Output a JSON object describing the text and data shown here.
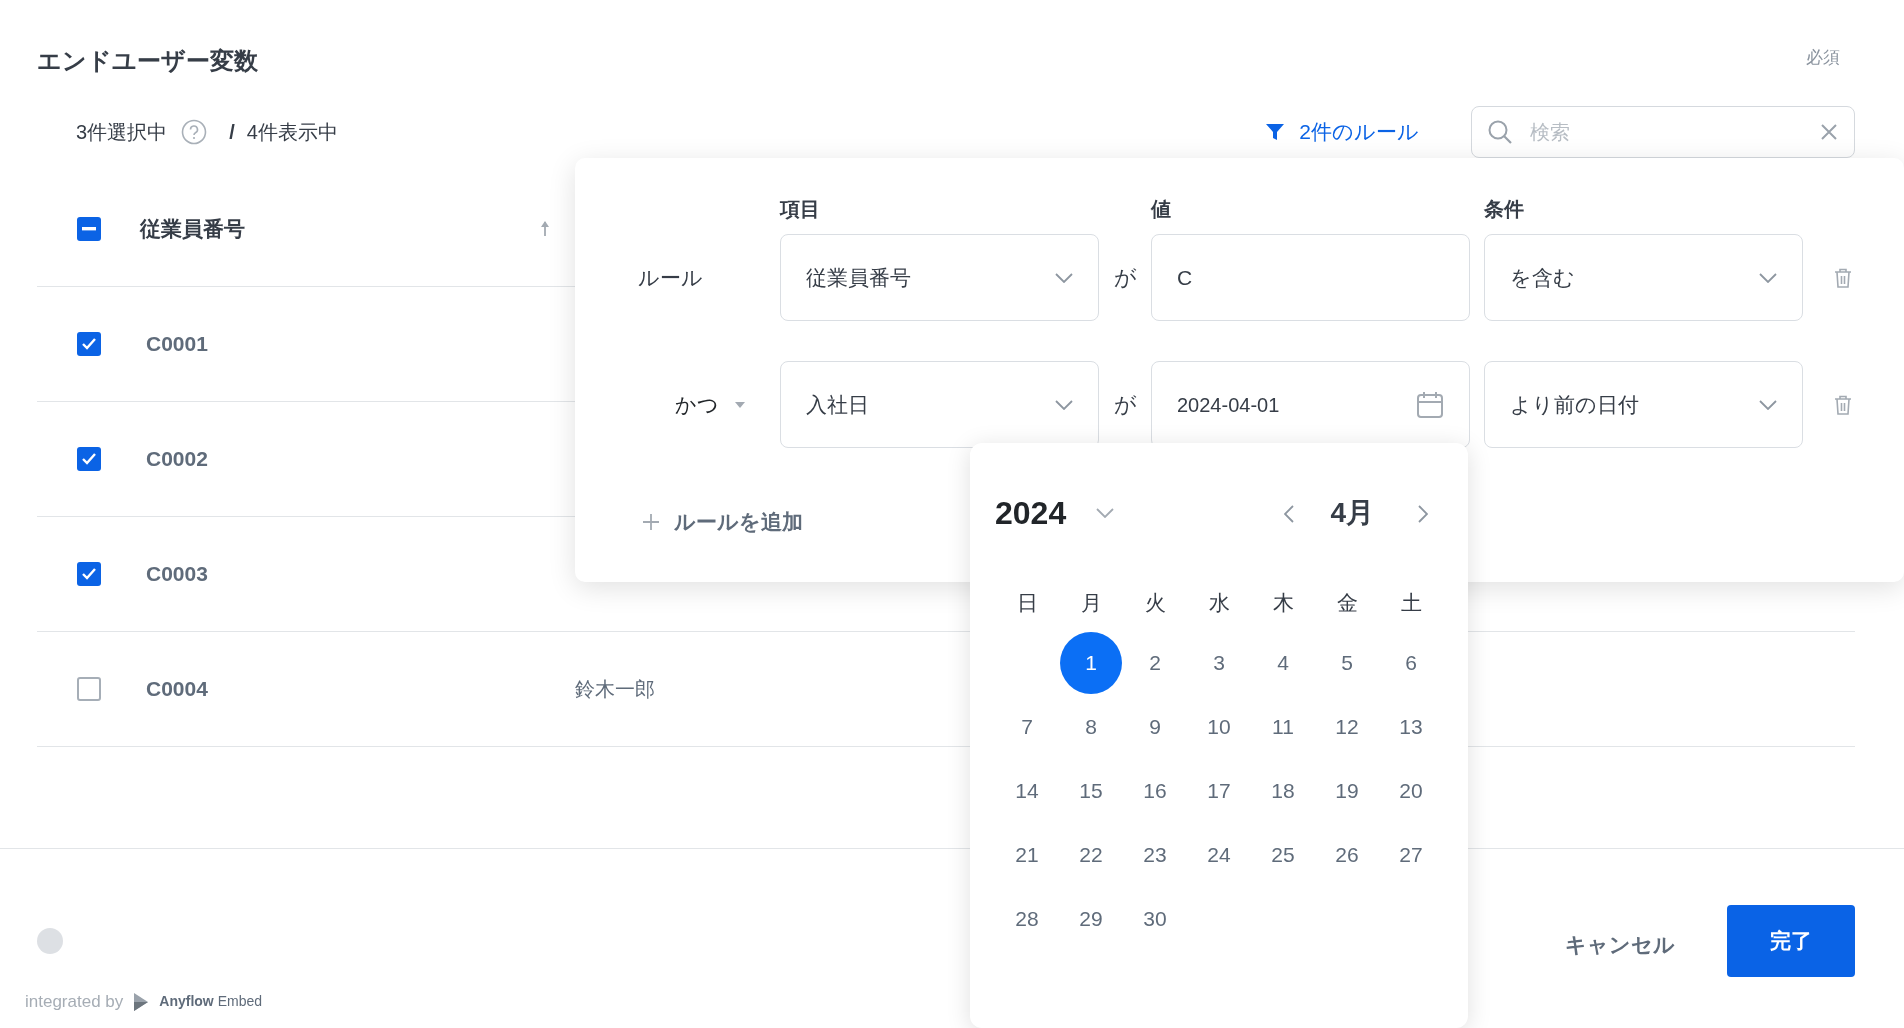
{
  "title": "エンドユーザー変数",
  "required_label": "必須",
  "selection": {
    "selected_text": "3件選択中",
    "separator": "/",
    "shown_text": "4件表示中"
  },
  "filter_button": {
    "label": "2件のルール"
  },
  "search": {
    "placeholder": "検索"
  },
  "table": {
    "header_checked": true,
    "header_indeterminate": true,
    "columns": [
      {
        "label": "従業員番号",
        "sorted_ascending": true
      }
    ],
    "rows": [
      {
        "checked": true,
        "cells": [
          "C0001"
        ]
      },
      {
        "checked": true,
        "cells": [
          "C0002"
        ]
      },
      {
        "checked": true,
        "cells": [
          "C0003"
        ]
      },
      {
        "checked": false,
        "cells": [
          "C0004",
          "鈴木一郎"
        ]
      }
    ]
  },
  "filter_panel": {
    "columns": [
      "項目",
      "値",
      "条件"
    ],
    "rules": [
      {
        "label": {
          "kind": "text",
          "text": "ルール"
        },
        "field": "従業員番号",
        "connector": "が",
        "value": {
          "kind": "text",
          "text": "C"
        },
        "condition": "を含む"
      },
      {
        "label": {
          "kind": "dropdown",
          "text": "かつ"
        },
        "field": "入社日",
        "connector": "が",
        "value": {
          "kind": "date",
          "text": "2024-04-01"
        },
        "condition": "より前の日付"
      }
    ],
    "add_rule": "ルールを追加"
  },
  "date_picker": {
    "year": "2024",
    "month": "4月",
    "weekdays": [
      "日",
      "月",
      "火",
      "水",
      "木",
      "金",
      "土"
    ],
    "weeks": [
      [
        {
          "label": "1",
          "selected": true
        },
        {
          "label": "2",
          "selected": false
        },
        {
          "label": "3",
          "selected": false
        },
        {
          "label": "4",
          "selected": false
        },
        {
          "label": "5",
          "selected": false
        },
        {
          "label": "6",
          "selected": false
        }
      ],
      [
        {
          "label": "7",
          "selected": false
        },
        {
          "label": "8",
          "selected": false
        },
        {
          "label": "9",
          "selected": false
        },
        {
          "label": "10",
          "selected": false
        },
        {
          "label": "11",
          "selected": false
        },
        {
          "label": "12",
          "selected": false
        },
        {
          "label": "13",
          "selected": false
        }
      ],
      [
        {
          "label": "14",
          "selected": false
        },
        {
          "label": "15",
          "selected": false
        },
        {
          "label": "16",
          "selected": false
        },
        {
          "label": "17",
          "selected": false
        },
        {
          "label": "18",
          "selected": false
        },
        {
          "label": "19",
          "selected": false
        },
        {
          "label": "20",
          "selected": false
        }
      ],
      [
        {
          "label": "21",
          "selected": false
        },
        {
          "label": "22",
          "selected": false
        },
        {
          "label": "23",
          "selected": false
        },
        {
          "label": "24",
          "selected": false
        },
        {
          "label": "25",
          "selected": false
        },
        {
          "label": "26",
          "selected": false
        },
        {
          "label": "27",
          "selected": false
        }
      ],
      [
        {
          "label": "28",
          "selected": false
        },
        {
          "label": "29",
          "selected": false
        },
        {
          "label": "30",
          "selected": false
        }
      ]
    ]
  },
  "footer": {
    "brand_prefix": "integrated by",
    "brand_name": "Anyflow",
    "brand_suffix": "Embed",
    "cancel": "キャンセル",
    "done": "完了"
  }
}
